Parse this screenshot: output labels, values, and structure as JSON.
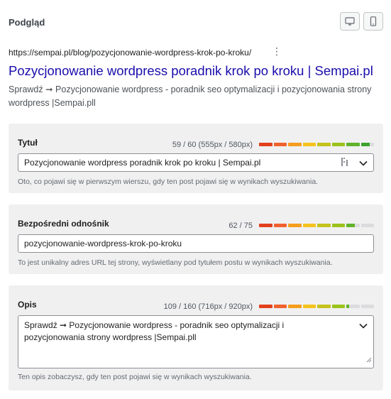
{
  "header": {
    "title": "Podgląd",
    "desktop_icon": "desktop-icon",
    "mobile_icon": "mobile-icon"
  },
  "serp": {
    "url": "https://sempai.pl/blog/pozycjonowanie-wordpress-krok-po-kroku/",
    "more_icon": "⋮",
    "title": "Pozycjonowanie wordpress poradnik krok po kroku | Sempai.pl",
    "description": "Sprawdź ➞ Pozycjonowanie wordpress - poradnik seo optymalizacji i pozycjonowania strony wordpress |Sempai.pll"
  },
  "title_field": {
    "label": "Tytuł",
    "counter": "59 / 60 (555px / 580px)",
    "value": "Pozycjonowanie wordpress poradnik krok po kroku | Sempai.pl",
    "help": "Oto, co pojawi się w pierwszym wierszu, gdy ten post pojawi się w wynikach wyszukiwania.",
    "meter_fill": 0.96,
    "icons": [
      "variables-icon",
      "chevron-down-icon"
    ]
  },
  "slug_field": {
    "label": "Bezpośredni odnośnik",
    "counter": "62 / 75",
    "value": "pozycjonowanie-wordpress-krok-po-kroku",
    "help": "To jest unikalny adres URL tej strony, wyświetlany pod tytułem postu w wynikach wyszukiwania.",
    "meter_fill": 0.83
  },
  "desc_field": {
    "label": "Opis",
    "counter": "109 / 160 (716px / 920px)",
    "value": "Sprawdź ➞ Pozycjonowanie wordpress - poradnik seo optymalizacji i pozycjonowania strony wordpress |Sempai.pll",
    "help": "Ten opis zobaczysz, gdy ten post pojawi się w wynikach wyszukiwania.",
    "meter_fill": 0.78,
    "icons": [
      "chevron-down-icon"
    ]
  },
  "colors": {
    "meter": [
      "#e2401c",
      "#f0612e",
      "#f59d1d",
      "#f5c31d",
      "#c4c21c",
      "#9cc21c",
      "#61b32b",
      "#3da22d"
    ],
    "meter_empty": "#dcdcde",
    "serp_title": "#1a0dab",
    "panel_bg": "#f0f0f1"
  }
}
